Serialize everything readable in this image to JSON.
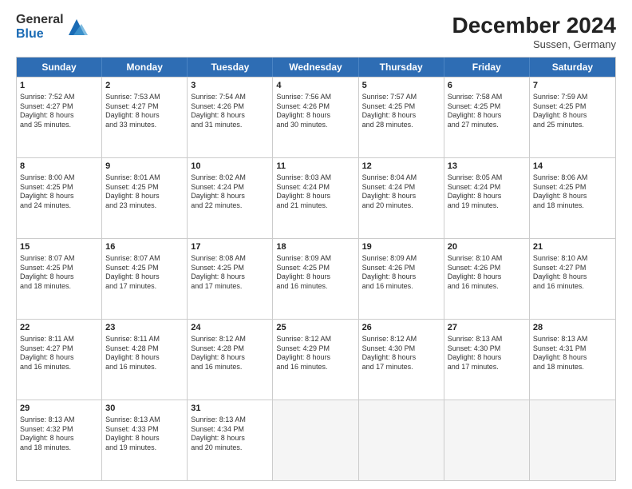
{
  "logo": {
    "line1": "General",
    "line2": "Blue"
  },
  "title": "December 2024",
  "subtitle": "Sussen, Germany",
  "days": [
    "Sunday",
    "Monday",
    "Tuesday",
    "Wednesday",
    "Thursday",
    "Friday",
    "Saturday"
  ],
  "rows": [
    [
      {
        "day": "",
        "empty": true
      },
      {
        "day": "1",
        "lines": [
          "Sunrise: 7:52 AM",
          "Sunset: 4:27 PM",
          "Daylight: 8 hours",
          "and 35 minutes."
        ]
      },
      {
        "day": "2",
        "lines": [
          "Sunrise: 7:53 AM",
          "Sunset: 4:27 PM",
          "Daylight: 8 hours",
          "and 33 minutes."
        ]
      },
      {
        "day": "3",
        "lines": [
          "Sunrise: 7:54 AM",
          "Sunset: 4:26 PM",
          "Daylight: 8 hours",
          "and 31 minutes."
        ]
      },
      {
        "day": "4",
        "lines": [
          "Sunrise: 7:56 AM",
          "Sunset: 4:26 PM",
          "Daylight: 8 hours",
          "and 30 minutes."
        ]
      },
      {
        "day": "5",
        "lines": [
          "Sunrise: 7:57 AM",
          "Sunset: 4:25 PM",
          "Daylight: 8 hours",
          "and 28 minutes."
        ]
      },
      {
        "day": "6",
        "lines": [
          "Sunrise: 7:58 AM",
          "Sunset: 4:25 PM",
          "Daylight: 8 hours",
          "and 27 minutes."
        ]
      },
      {
        "day": "7",
        "lines": [
          "Sunrise: 7:59 AM",
          "Sunset: 4:25 PM",
          "Daylight: 8 hours",
          "and 25 minutes."
        ]
      }
    ],
    [
      {
        "day": "8",
        "lines": [
          "Sunrise: 8:00 AM",
          "Sunset: 4:25 PM",
          "Daylight: 8 hours",
          "and 24 minutes."
        ]
      },
      {
        "day": "9",
        "lines": [
          "Sunrise: 8:01 AM",
          "Sunset: 4:25 PM",
          "Daylight: 8 hours",
          "and 23 minutes."
        ]
      },
      {
        "day": "10",
        "lines": [
          "Sunrise: 8:02 AM",
          "Sunset: 4:24 PM",
          "Daylight: 8 hours",
          "and 22 minutes."
        ]
      },
      {
        "day": "11",
        "lines": [
          "Sunrise: 8:03 AM",
          "Sunset: 4:24 PM",
          "Daylight: 8 hours",
          "and 21 minutes."
        ]
      },
      {
        "day": "12",
        "lines": [
          "Sunrise: 8:04 AM",
          "Sunset: 4:24 PM",
          "Daylight: 8 hours",
          "and 20 minutes."
        ]
      },
      {
        "day": "13",
        "lines": [
          "Sunrise: 8:05 AM",
          "Sunset: 4:24 PM",
          "Daylight: 8 hours",
          "and 19 minutes."
        ]
      },
      {
        "day": "14",
        "lines": [
          "Sunrise: 8:06 AM",
          "Sunset: 4:25 PM",
          "Daylight: 8 hours",
          "and 18 minutes."
        ]
      }
    ],
    [
      {
        "day": "15",
        "lines": [
          "Sunrise: 8:07 AM",
          "Sunset: 4:25 PM",
          "Daylight: 8 hours",
          "and 18 minutes."
        ]
      },
      {
        "day": "16",
        "lines": [
          "Sunrise: 8:07 AM",
          "Sunset: 4:25 PM",
          "Daylight: 8 hours",
          "and 17 minutes."
        ]
      },
      {
        "day": "17",
        "lines": [
          "Sunrise: 8:08 AM",
          "Sunset: 4:25 PM",
          "Daylight: 8 hours",
          "and 17 minutes."
        ]
      },
      {
        "day": "18",
        "lines": [
          "Sunrise: 8:09 AM",
          "Sunset: 4:25 PM",
          "Daylight: 8 hours",
          "and 16 minutes."
        ]
      },
      {
        "day": "19",
        "lines": [
          "Sunrise: 8:09 AM",
          "Sunset: 4:26 PM",
          "Daylight: 8 hours",
          "and 16 minutes."
        ]
      },
      {
        "day": "20",
        "lines": [
          "Sunrise: 8:10 AM",
          "Sunset: 4:26 PM",
          "Daylight: 8 hours",
          "and 16 minutes."
        ]
      },
      {
        "day": "21",
        "lines": [
          "Sunrise: 8:10 AM",
          "Sunset: 4:27 PM",
          "Daylight: 8 hours",
          "and 16 minutes."
        ]
      }
    ],
    [
      {
        "day": "22",
        "lines": [
          "Sunrise: 8:11 AM",
          "Sunset: 4:27 PM",
          "Daylight: 8 hours",
          "and 16 minutes."
        ]
      },
      {
        "day": "23",
        "lines": [
          "Sunrise: 8:11 AM",
          "Sunset: 4:28 PM",
          "Daylight: 8 hours",
          "and 16 minutes."
        ]
      },
      {
        "day": "24",
        "lines": [
          "Sunrise: 8:12 AM",
          "Sunset: 4:28 PM",
          "Daylight: 8 hours",
          "and 16 minutes."
        ]
      },
      {
        "day": "25",
        "lines": [
          "Sunrise: 8:12 AM",
          "Sunset: 4:29 PM",
          "Daylight: 8 hours",
          "and 16 minutes."
        ]
      },
      {
        "day": "26",
        "lines": [
          "Sunrise: 8:12 AM",
          "Sunset: 4:30 PM",
          "Daylight: 8 hours",
          "and 17 minutes."
        ]
      },
      {
        "day": "27",
        "lines": [
          "Sunrise: 8:13 AM",
          "Sunset: 4:30 PM",
          "Daylight: 8 hours",
          "and 17 minutes."
        ]
      },
      {
        "day": "28",
        "lines": [
          "Sunrise: 8:13 AM",
          "Sunset: 4:31 PM",
          "Daylight: 8 hours",
          "and 18 minutes."
        ]
      }
    ],
    [
      {
        "day": "29",
        "lines": [
          "Sunrise: 8:13 AM",
          "Sunset: 4:32 PM",
          "Daylight: 8 hours",
          "and 18 minutes."
        ]
      },
      {
        "day": "30",
        "lines": [
          "Sunrise: 8:13 AM",
          "Sunset: 4:33 PM",
          "Daylight: 8 hours",
          "and 19 minutes."
        ]
      },
      {
        "day": "31",
        "lines": [
          "Sunrise: 8:13 AM",
          "Sunset: 4:34 PM",
          "Daylight: 8 hours",
          "and 20 minutes."
        ]
      },
      {
        "day": "",
        "empty": true
      },
      {
        "day": "",
        "empty": true
      },
      {
        "day": "",
        "empty": true
      },
      {
        "day": "",
        "empty": true
      }
    ]
  ]
}
